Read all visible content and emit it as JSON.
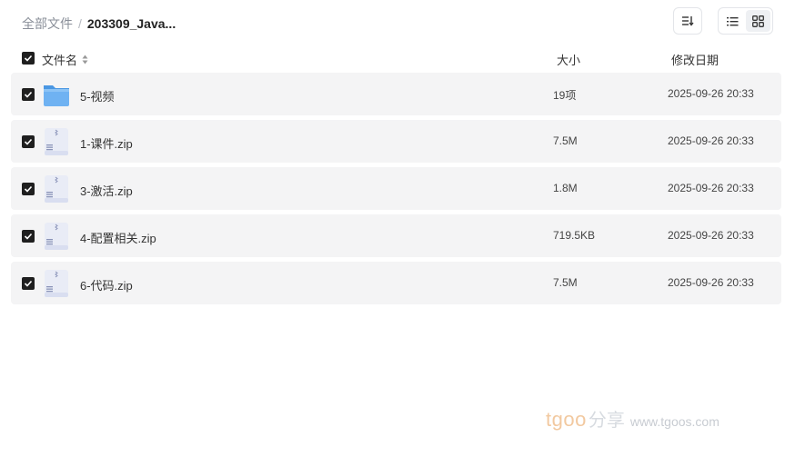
{
  "breadcrumb": {
    "root": "全部文件",
    "separator": "/",
    "current": "203309_Java..."
  },
  "toolbar": {
    "sort_icon": "sort-list-icon",
    "view_list_icon": "list-view-icon",
    "view_grid_icon": "grid-view-icon"
  },
  "table": {
    "columns": {
      "name": "文件名",
      "size": "大小",
      "date": "修改日期"
    },
    "rows": [
      {
        "name": "5-视频",
        "size": "19项",
        "date": "2025-09-26 20:33",
        "type": "folder"
      },
      {
        "name": "1-课件.zip",
        "size": "7.5M",
        "date": "2025-09-26 20:33",
        "type": "zip"
      },
      {
        "name": "3-激活.zip",
        "size": "1.8M",
        "date": "2025-09-26 20:33",
        "type": "zip"
      },
      {
        "name": "4-配置相关.zip",
        "size": "719.5KB",
        "date": "2025-09-26 20:33",
        "type": "zip"
      },
      {
        "name": "6-代码.zip",
        "size": "7.5M",
        "date": "2025-09-26 20:33",
        "type": "zip"
      }
    ]
  },
  "watermark": {
    "brand": "tgoo",
    "share": "分享",
    "url": "www.tgoos.com"
  },
  "colors": {
    "row_bg": "#f4f4f5",
    "checkbox": "#1f1f1f",
    "folder": "#5aa7ee",
    "zip_bg": "#e9ecf6"
  }
}
